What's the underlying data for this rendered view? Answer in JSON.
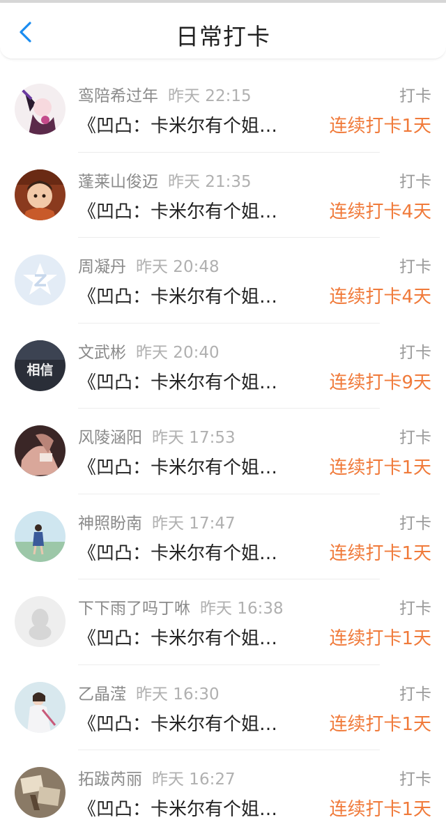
{
  "header": {
    "title": "日常打卡",
    "back_icon": "chevron-left-icon"
  },
  "colors": {
    "accent": "#1a8cf0",
    "streak": "#f07a3a"
  },
  "items": [
    {
      "name": "鸾陪希过年",
      "time": "昨天 22:15",
      "tag": "打卡",
      "content": "《凹凸：卡米尔有个姐…",
      "streak": "连续打卡1天"
    },
    {
      "name": "蓬莱山俊迈",
      "time": "昨天 21:35",
      "tag": "打卡",
      "content": "《凹凸：卡米尔有个姐…",
      "streak": "连续打卡4天"
    },
    {
      "name": "周凝丹",
      "time": "昨天 20:48",
      "tag": "打卡",
      "content": "《凹凸：卡米尔有个姐…",
      "streak": "连续打卡4天"
    },
    {
      "name": "文武彬",
      "time": "昨天 20:40",
      "tag": "打卡",
      "content": "《凹凸：卡米尔有个姐…",
      "streak": "连续打卡9天",
      "avatar_text": "相信"
    },
    {
      "name": "风陵涵阳",
      "time": "昨天 17:53",
      "tag": "打卡",
      "content": "《凹凸：卡米尔有个姐…",
      "streak": "连续打卡1天"
    },
    {
      "name": "神照盼南",
      "time": "昨天 17:47",
      "tag": "打卡",
      "content": "《凹凸：卡米尔有个姐…",
      "streak": "连续打卡1天"
    },
    {
      "name": "下下雨了吗丁咻",
      "time": "昨天 16:38",
      "tag": "打卡",
      "content": "《凹凸：卡米尔有个姐…",
      "streak": "连续打卡1天"
    },
    {
      "name": "乙晶滢",
      "time": "昨天 16:30",
      "tag": "打卡",
      "content": "《凹凸：卡米尔有个姐…",
      "streak": "连续打卡1天"
    },
    {
      "name": "拓跋芮丽",
      "time": "昨天 16:27",
      "tag": "打卡",
      "content": "《凹凸：卡米尔有个姐…",
      "streak": "连续打卡1天"
    }
  ]
}
